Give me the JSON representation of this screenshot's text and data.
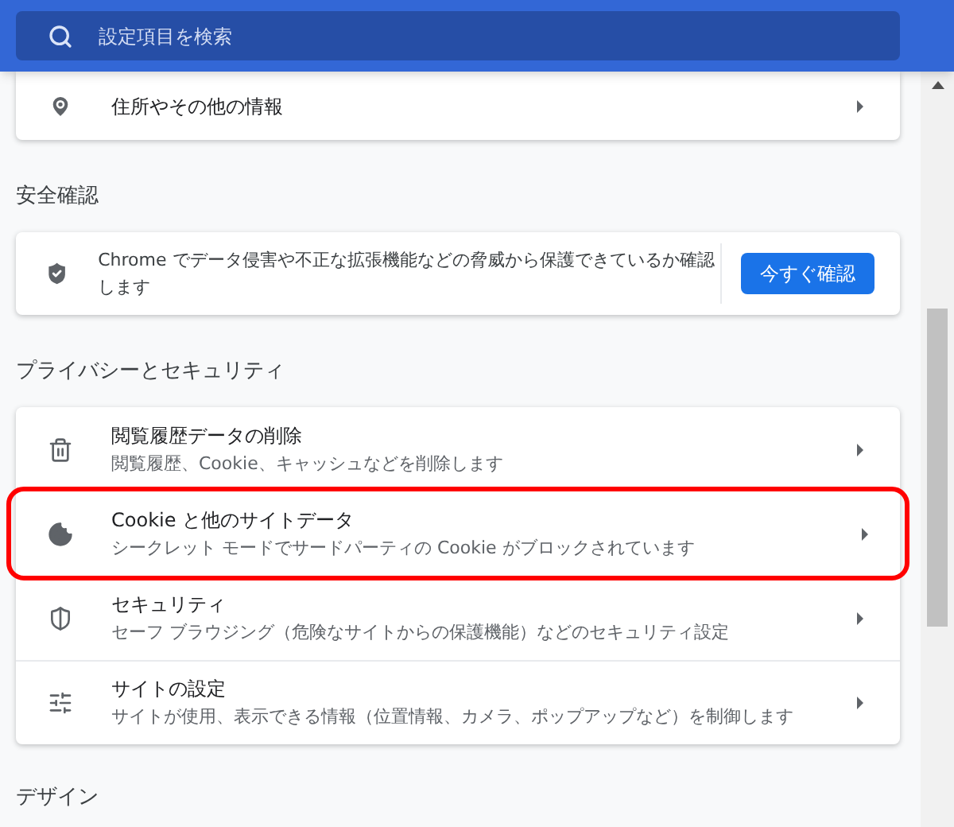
{
  "search": {
    "placeholder": "設定項目を検索"
  },
  "top_card": {
    "rows": [
      {
        "title": "住所やその他の情報"
      }
    ]
  },
  "safety": {
    "heading": "安全確認",
    "text": "Chrome でデータ侵害や不正な拡張機能などの脅威から保護できているか確認します",
    "button": "今すぐ確認"
  },
  "privacy": {
    "heading": "プライバシーとセキュリティ",
    "rows": [
      {
        "title": "閲覧履歴データの削除",
        "subtitle": "閲覧履歴、Cookie、キャッシュなどを削除します",
        "highlighted": false
      },
      {
        "title": "Cookie と他のサイトデータ",
        "subtitle": "シークレット モードでサードパーティの Cookie がブロックされています",
        "highlighted": true
      },
      {
        "title": "セキュリティ",
        "subtitle": "セーフ ブラウジング（危険なサイトからの保護機能）などのセキュリティ設定",
        "highlighted": false
      },
      {
        "title": "サイトの設定",
        "subtitle": "サイトが使用、表示できる情報（位置情報、カメラ、ポップアップなど）を制御します",
        "highlighted": false
      }
    ]
  },
  "design": {
    "heading": "デザイン"
  }
}
